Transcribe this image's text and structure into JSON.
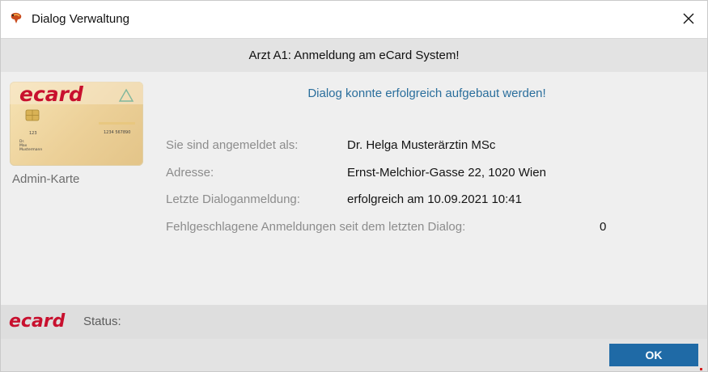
{
  "window": {
    "title": "Dialog Verwaltung"
  },
  "header": {
    "title": "Arzt A1: Anmeldung am eCard System!"
  },
  "main": {
    "success_message": "Dialog konnte erfolgreich aufgebaut werden!",
    "card": {
      "brand": "ecard",
      "number_left": "123",
      "label_top": "Dr.",
      "label_name1": "Max",
      "label_name2": "Mustermann",
      "number_right": "1234 567890",
      "caption": "Admin-Karte"
    },
    "fields": [
      {
        "label": "Sie sind angemeldet als:",
        "value": "Dr. Helga Musterärztin MSc"
      },
      {
        "label": "Adresse:",
        "value": "Ernst-Melchior-Gasse 22, 1020 Wien"
      },
      {
        "label": "Letzte Dialoganmeldung:",
        "value": "erfolgreich am 10.09.2021 10:41"
      },
      {
        "label": "Fehlgeschlagene Anmeldungen seit dem letzten Dialog:",
        "value": "0"
      }
    ]
  },
  "status": {
    "logo_text": "ecard",
    "label": "Status:"
  },
  "footer": {
    "ok_label": "OK"
  },
  "colors": {
    "accent": "#1f6aa6",
    "message": "#2a6e9c",
    "logo_red": "#c8102e"
  }
}
